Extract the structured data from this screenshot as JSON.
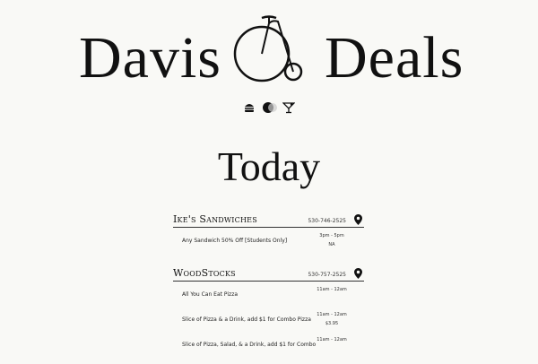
{
  "header": {
    "title_left": "Davis",
    "title_right": "Deals",
    "categories": [
      "burger-icon",
      "food-icon",
      "cocktail-icon"
    ]
  },
  "main": {
    "heading": "Today"
  },
  "restaurants": [
    {
      "name": "Ike's Sandwiches",
      "phone": "530-746-2525",
      "deals": [
        {
          "description": "Any Sandwich 50% Off [Students Only]",
          "time": "3pm - 5pm",
          "price": "NA"
        }
      ]
    },
    {
      "name": "WoodStocks",
      "phone": "530-757-2525",
      "deals": [
        {
          "description": "All You Can Eat Pizza",
          "time": "11am - 12am",
          "price": ""
        },
        {
          "description": "Slice of Pizza & a Drink, add $1 for Combo Pizza",
          "time": "11am - 12am",
          "price": "$3.95"
        },
        {
          "description": "Slice of Pizza, Salad, & a Drink, add $1 for Combo",
          "time": "11am - 12am",
          "price": ""
        }
      ]
    }
  ]
}
